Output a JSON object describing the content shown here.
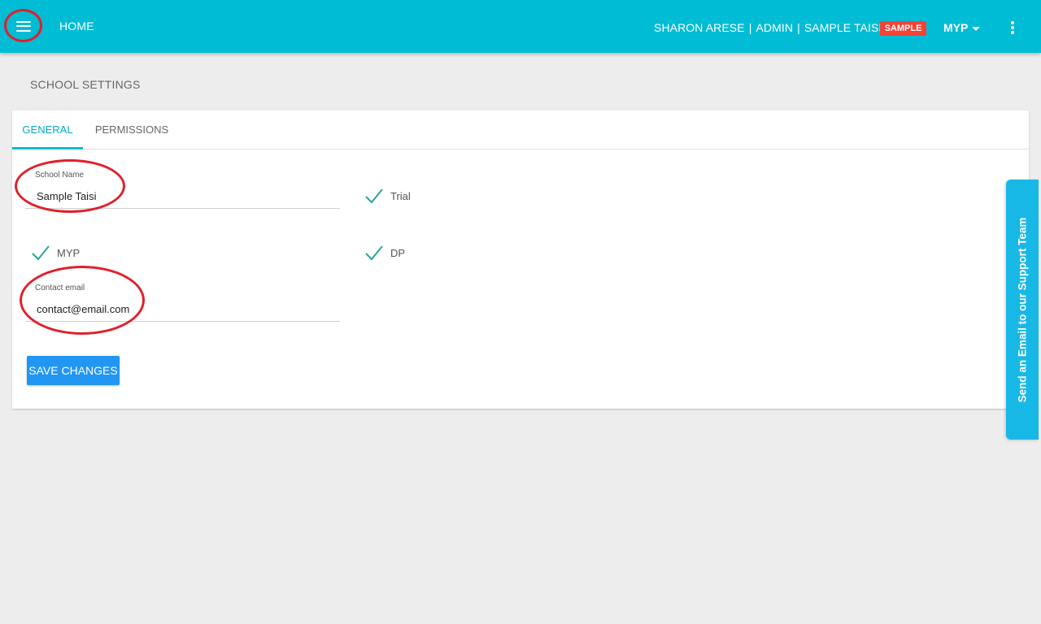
{
  "header": {
    "home_label": "HOME",
    "user_name": "SHARON ARESE",
    "role": "ADMIN",
    "school": "SAMPLE TAISI",
    "badge": "SAMPLE",
    "program": "MYP"
  },
  "page": {
    "title": "SCHOOL SETTINGS"
  },
  "tabs": [
    {
      "label": "GENERAL",
      "active": true
    },
    {
      "label": "PERMISSIONS",
      "active": false
    }
  ],
  "form": {
    "school_name": {
      "label": "School Name",
      "value": "Sample Taisi"
    },
    "contact_email": {
      "label": "Contact email",
      "value": "contact@email.com"
    },
    "checks": {
      "trial": {
        "label": "Trial",
        "checked": true
      },
      "myp": {
        "label": "MYP",
        "checked": true
      },
      "dp": {
        "label": "DP",
        "checked": true
      }
    },
    "save_label": "SAVE CHANGES"
  },
  "support": {
    "label": "Send an Email to our Support Team"
  },
  "colors": {
    "header_bg": "#00bcd4",
    "badge_bg": "#f44336",
    "save_button": "#2196f3",
    "check_color": "#26a69a",
    "annotation": "#e0202a"
  },
  "icons": {
    "menu": "menu-icon",
    "caret": "caret-down-icon",
    "more": "more-vert-icon",
    "check": "check-icon"
  }
}
